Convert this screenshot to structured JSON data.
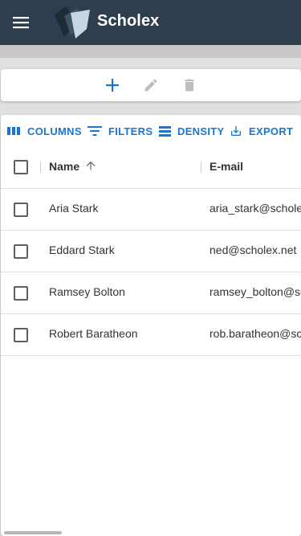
{
  "app": {
    "title": "Scholex",
    "menu_icon": "menu-icon",
    "logo_icon": "scholex-logo",
    "colors": {
      "appbar": "#2f3e4e",
      "accent": "#1976d2"
    }
  },
  "actions": [
    {
      "icon": "add-icon",
      "color": "#1976d2"
    },
    {
      "icon": "edit-icon",
      "color": "#bdbdbd"
    },
    {
      "icon": "delete-icon",
      "color": "#bdbdbd"
    }
  ],
  "toolbar": {
    "columns_label": "COLUMNS",
    "filters_label": "FILTERS",
    "density_label": "DENSITY",
    "export_label": "EXPORT"
  },
  "table": {
    "columns": [
      "Name",
      "E-mail"
    ],
    "sort": {
      "column": "Name",
      "direction": "ascending"
    },
    "rows": [
      {
        "name": "Aria Stark",
        "email": "aria_stark@scholex.net"
      },
      {
        "name": "Eddard Stark",
        "email": "ned@scholex.net"
      },
      {
        "name": "Ramsey Bolton",
        "email": "ramsey_bolton@scholex.net"
      },
      {
        "name": "Robert Baratheon",
        "email": "rob.baratheon@scholex.net"
      }
    ]
  }
}
